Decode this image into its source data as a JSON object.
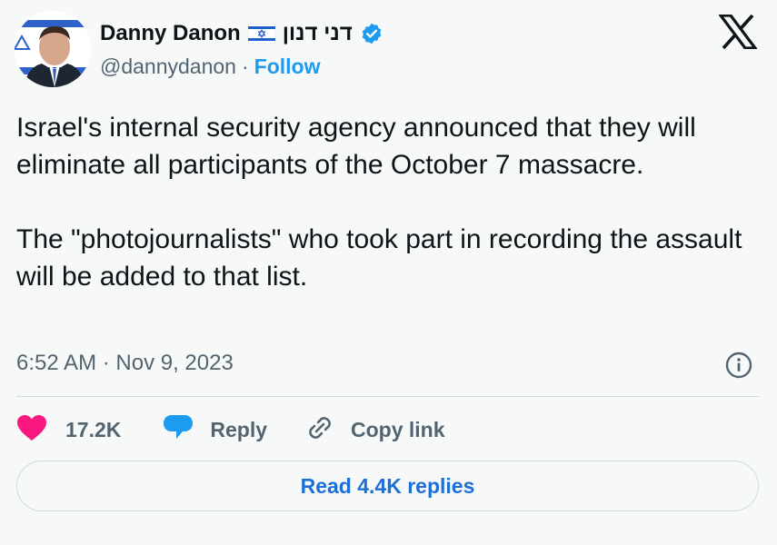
{
  "author": {
    "display_name": "Danny Danon",
    "hebrew_name": "דני דנון",
    "handle": "@dannydanon",
    "separator": "·",
    "follow_label": "Follow"
  },
  "tweet": {
    "paragraphs": [
      "Israel's internal security agency announced that they will eliminate all participants of the October 7 massacre.",
      "The \"photojournalists\" who took part in recording the assault will be added to that list."
    ],
    "timestamp": "6:52 AM · Nov 9, 2023"
  },
  "actions": {
    "like_count": "17.2K",
    "reply_label": "Reply",
    "copy_link_label": "Copy link"
  },
  "read_replies_label": "Read 4.4K replies",
  "icons": {
    "flag": "israel-flag-icon",
    "verified": "verified-badge-icon",
    "logo": "x-logo-icon",
    "info": "info-icon",
    "like": "heart-icon",
    "reply": "speech-bubble-icon",
    "copy": "link-icon"
  },
  "colors": {
    "accent": "#1d9bf0",
    "like": "#f91880",
    "text": "#0f1419",
    "muted": "#536471",
    "background": "#f7f9f9"
  }
}
